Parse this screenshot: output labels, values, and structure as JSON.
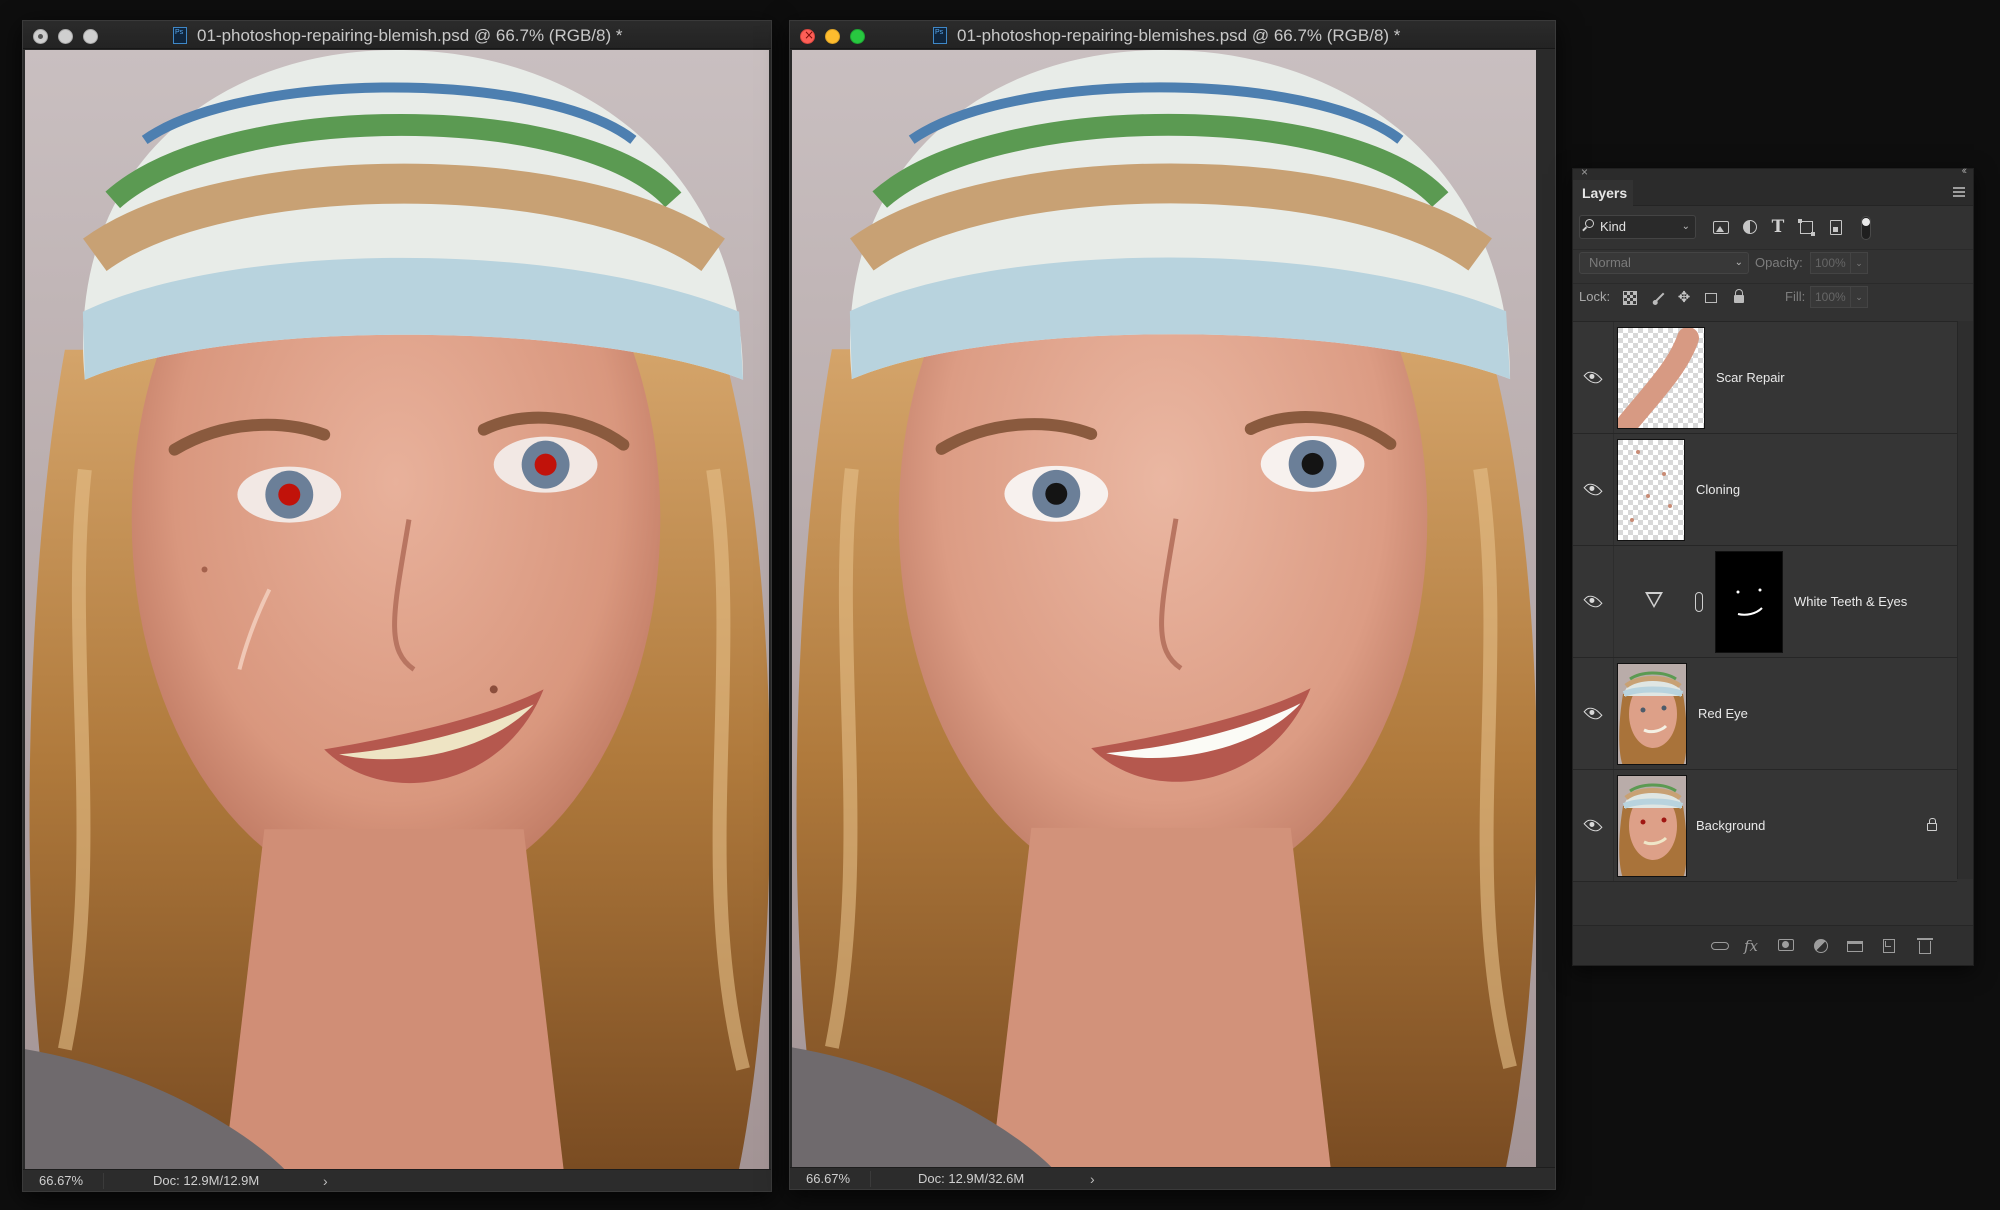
{
  "windows": [
    {
      "title": "01-photoshop-repairing-blemish.psd @ 66.7% (RGB/8) *",
      "zoom": "66.67%",
      "doc_size": "Doc: 12.9M/12.9M",
      "status_arrow": "›",
      "active": false
    },
    {
      "title": "01-photoshop-repairing-blemishes.psd @ 66.7% (RGB/8) *",
      "zoom": "66.67%",
      "doc_size": "Doc: 12.9M/32.6M",
      "status_arrow": "›",
      "active": true
    }
  ],
  "layers_panel": {
    "tab_label": "Layers",
    "filter_kind": "Kind",
    "blend_mode": "Normal",
    "opacity_label": "Opacity:",
    "opacity_value": "100%",
    "lock_label": "Lock:",
    "fill_label": "Fill:",
    "fill_value": "100%",
    "layers": [
      {
        "name": "Scar Repair",
        "visible": true
      },
      {
        "name": "Cloning",
        "visible": true
      },
      {
        "name": "White Teeth & Eyes",
        "visible": true
      },
      {
        "name": "Red Eye",
        "visible": true
      },
      {
        "name": "Background",
        "visible": true,
        "locked": true
      }
    ]
  },
  "colors": {
    "app_background": "#0e0e0e",
    "panel_background": "#323232",
    "close_red": "#fd5f57",
    "minimize_yellow": "#febc2e",
    "zoom_green": "#28c840"
  },
  "icons": {
    "filter_icons": [
      "pixel-layer-filter-icon",
      "adjustment-layer-filter-icon",
      "type-layer-filter-icon",
      "shape-layer-filter-icon",
      "smart-object-filter-icon"
    ],
    "lock_icons": [
      "lock-transparent-pixels-icon",
      "lock-image-pixels-icon",
      "lock-position-icon",
      "lock-artboard-icon",
      "lock-all-icon"
    ],
    "footer_icons": [
      "link-layers-icon",
      "layer-style-fx-icon",
      "add-mask-icon",
      "new-adjustment-layer-icon",
      "new-group-icon",
      "new-layer-icon",
      "delete-layer-icon"
    ]
  }
}
